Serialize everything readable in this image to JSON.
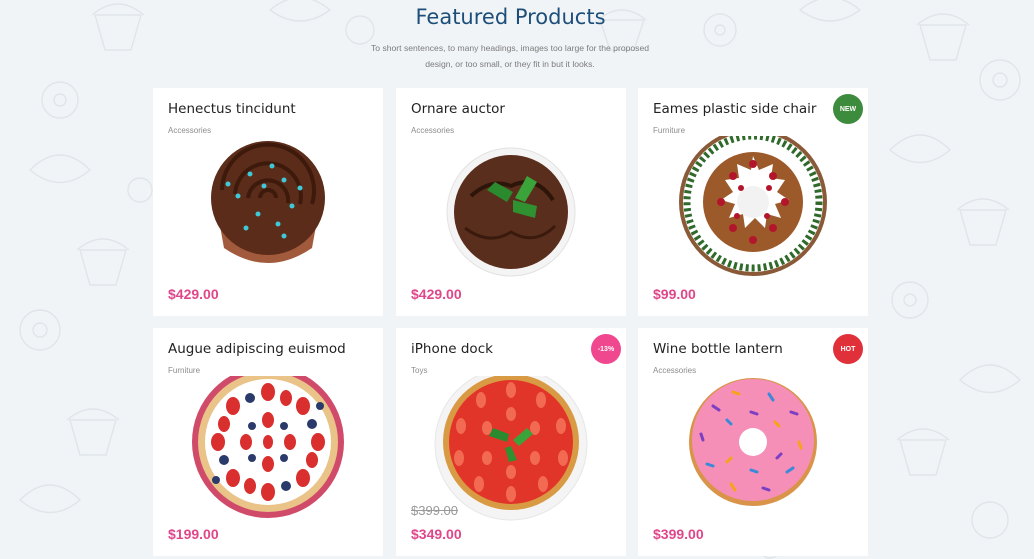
{
  "section": {
    "title": "Featured Products",
    "subtitle": "To short sentences, to many headings, images too large for the proposed design, or too small, or they fit in but it looks."
  },
  "colors": {
    "title": "#1d4e7a",
    "price": "#e0468a",
    "badge_new": "#3d8b3d",
    "badge_sale": "#f0488e",
    "badge_hot": "#e0303a",
    "background": "#f1f4f7"
  },
  "products": [
    {
      "name": "Henectus tincidunt",
      "category": "Accessories",
      "price": "$429.00",
      "image": "chocolate-cupcake-image"
    },
    {
      "name": "Ornare auctor",
      "category": "Accessories",
      "price": "$429.00",
      "image": "chocolate-muffin-image"
    },
    {
      "name": "Eames plastic side chair",
      "category": "Furniture",
      "price": "$99.00",
      "badge": "NEW",
      "image": "bundt-cake-image"
    },
    {
      "name": "Augue adipiscing euismod",
      "category": "Furniture",
      "price": "$199.00",
      "image": "berry-tart-image"
    },
    {
      "name": "iPhone dock",
      "category": "Toys",
      "price": "$349.00",
      "old_price": "$399.00",
      "badge": "-13%",
      "image": "strawberry-tart-image"
    },
    {
      "name": "Wine bottle lantern",
      "category": "Accessories",
      "price": "$399.00",
      "badge": "HOT",
      "image": "pink-donut-image"
    }
  ]
}
